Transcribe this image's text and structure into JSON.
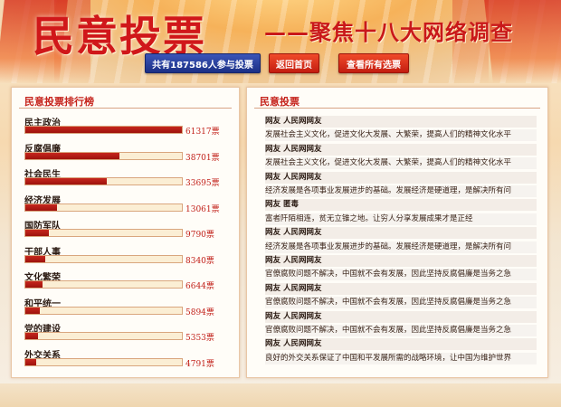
{
  "header": {
    "title": "民意投票",
    "subtitle": "——聚焦十八大网络调查",
    "vote_total_button": "共有187586人参与投票",
    "home_button": "返回首页",
    "view_all_button": "查看所有选票"
  },
  "ranking": {
    "title": "民意投票排行榜",
    "items": [
      {
        "label": "民主政治",
        "count": "61317票",
        "fraction": 1.0
      },
      {
        "label": "反腐倡廉",
        "count": "38701票",
        "fraction": 0.6
      },
      {
        "label": "社会民生",
        "count": "33695票",
        "fraction": 0.52
      },
      {
        "label": "经济发展",
        "count": "13061票",
        "fraction": 0.2
      },
      {
        "label": "国防军队",
        "count": "9790票",
        "fraction": 0.15
      },
      {
        "label": "干部人事",
        "count": "8340票",
        "fraction": 0.13
      },
      {
        "label": "文化繁荣",
        "count": "6644票",
        "fraction": 0.11
      },
      {
        "label": "和平统一",
        "count": "5894票",
        "fraction": 0.09
      },
      {
        "label": "党的建设",
        "count": "5353票",
        "fraction": 0.08
      },
      {
        "label": "外交关系",
        "count": "4791票",
        "fraction": 0.07
      }
    ]
  },
  "comments": {
    "title": "民意投票",
    "rows": [
      {
        "type": "user",
        "text": "网友 人民网网友"
      },
      {
        "type": "text",
        "text": "发展社会主义文化，促进文化大发展、大繁荣，提高人们的精神文化水平"
      },
      {
        "type": "user",
        "text": "网友 人民网网友"
      },
      {
        "type": "text",
        "text": "发展社会主义文化，促进文化大发展、大繁荣，提高人们的精神文化水平"
      },
      {
        "type": "user",
        "text": "网友 人民网网友"
      },
      {
        "type": "text",
        "text": "经济发展是各项事业发展进步的基础。发展经济是硬道理，是解决所有问"
      },
      {
        "type": "user",
        "text": "网友 匿毒"
      },
      {
        "type": "text",
        "text": "富者阡陌相连，贫无立锥之地。让穷人分享发展成果才是正经"
      },
      {
        "type": "user",
        "text": "网友 人民网网友"
      },
      {
        "type": "text",
        "text": "经济发展是各项事业发展进步的基础。发展经济是硬道理，是解决所有问"
      },
      {
        "type": "user",
        "text": "网友 人民网网友"
      },
      {
        "type": "text",
        "text": "官僚腐败问题不解决，中国就不会有发展，因此坚持反腐倡廉是当务之急"
      },
      {
        "type": "user",
        "text": "网友 人民网网友"
      },
      {
        "type": "text",
        "text": "官僚腐败问题不解决，中国就不会有发展，因此坚持反腐倡廉是当务之急"
      },
      {
        "type": "user",
        "text": "网友 人民网网友"
      },
      {
        "type": "text",
        "text": "官僚腐败问题不解决，中国就不会有发展，因此坚持反腐倡廉是当务之急"
      },
      {
        "type": "user",
        "text": "网友 人民网网友"
      },
      {
        "type": "text",
        "text": "良好的外交关系保证了中国和平发展所需的战略环境，让中国为维护世界"
      }
    ]
  },
  "colors": {
    "accent_red": "#c5221b",
    "button_blue": "#1b2f85",
    "bar_red": "#9e130d"
  }
}
